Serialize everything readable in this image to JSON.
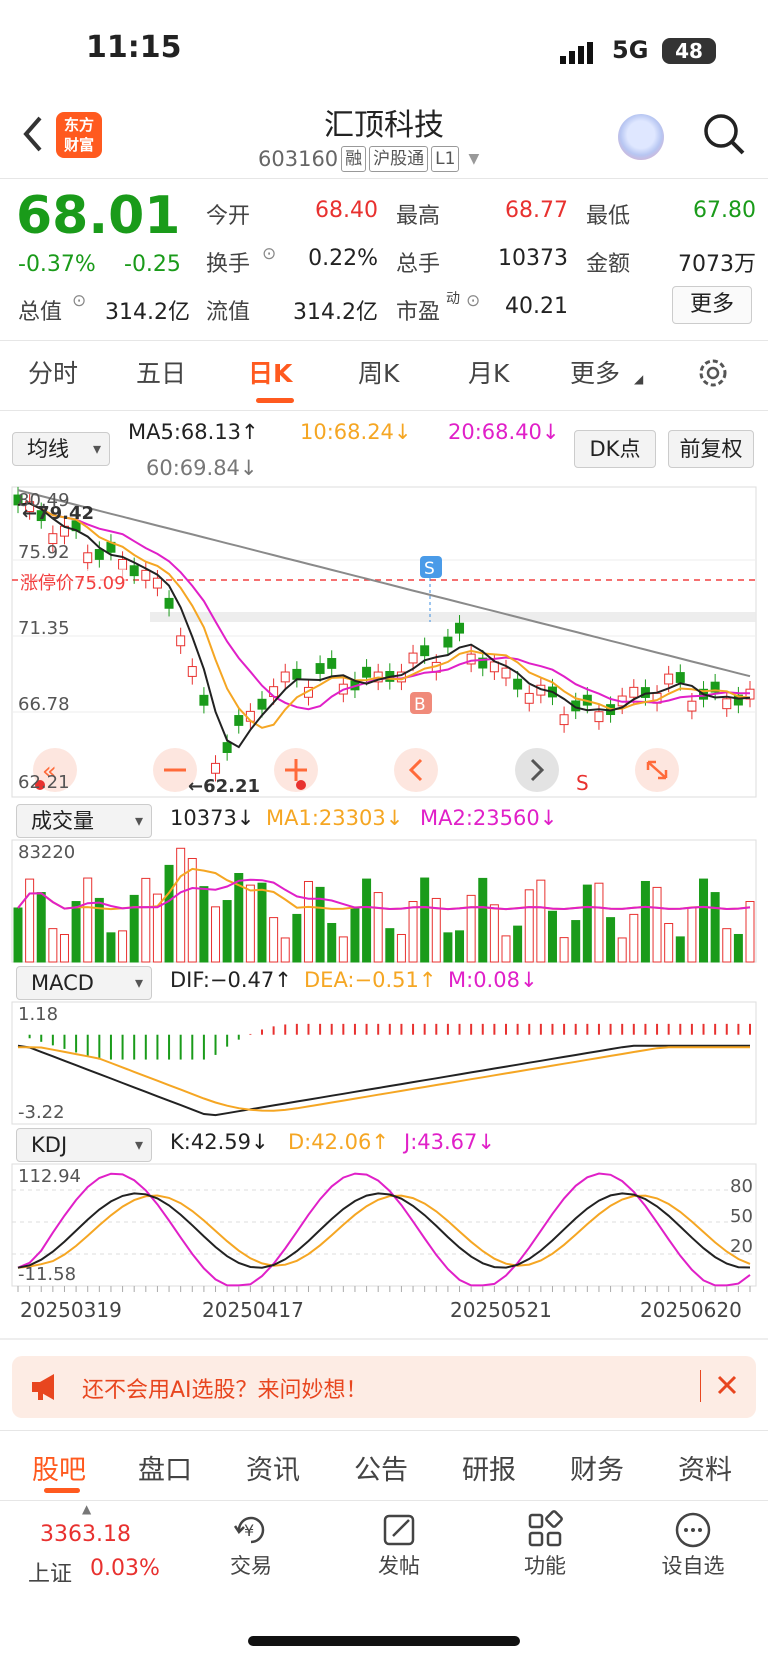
{
  "status_bar": {
    "time": "11:15",
    "network": "5G",
    "battery": "48"
  },
  "header": {
    "logo_text_1": "东方",
    "logo_text_2": "财富",
    "stock_name": "汇顶科技",
    "stock_code": "603160",
    "tags": [
      "融",
      "沪股通",
      "L1"
    ]
  },
  "quote": {
    "price": "68.01",
    "change_pct": "-0.37%",
    "change_amt": "-0.25",
    "open_label": "今开",
    "open": "68.40",
    "high_label": "最高",
    "high": "68.77",
    "low_label": "最低",
    "low": "67.80",
    "turnover_label": "换手",
    "turnover": "0.22%",
    "volume_label": "总手",
    "volume": "10373",
    "amount_label": "金额",
    "amount": "7073万",
    "mktcap_label": "总值",
    "mktcap": "314.2亿",
    "float_label": "流值",
    "float_cap": "314.2亿",
    "pe_label": "市盈",
    "pe_sup": "动",
    "pe": "40.21",
    "more_label": "更多"
  },
  "kline_tabs": [
    "分时",
    "五日",
    "日K",
    "周K",
    "月K",
    "更多"
  ],
  "active_tab": "日K",
  "ma_row": {
    "select": "均线",
    "ma5": "MA5:68.13↑",
    "ma10": "10:68.24↓",
    "ma20": "20:68.40↓",
    "ma60": "60:69.84↓",
    "dk_button": "DK点",
    "adjust_button": "前复权"
  },
  "main_chart": {
    "y_labels": [
      "80.49",
      "75.92",
      "71.35",
      "66.78",
      "62.21"
    ],
    "max_marker": "←79.42",
    "min_marker": "←62.21",
    "limit_label": "涨停价75.09",
    "buy_marker": "B",
    "sell_marker": "S",
    "s_marker": "S"
  },
  "volume_row": {
    "select": "成交量",
    "vol": "10373↓",
    "ma1": "MA1:23303↓",
    "ma2": "MA2:23560↓",
    "y_label": "83220"
  },
  "macd_row": {
    "select": "MACD",
    "dif": "DIF:−0.47↑",
    "dea": "DEA:−0.51↑",
    "m": "M:0.08↓",
    "y_top": "1.18",
    "y_bottom": "-3.22"
  },
  "kdj_row": {
    "select": "KDJ",
    "k": "K:42.59↓",
    "d": "D:42.06↑",
    "j": "J:43.67↓",
    "y_top": "112.94",
    "y_bottom": "-11.58",
    "levels": [
      "80",
      "50",
      "20"
    ]
  },
  "dates": [
    "20250319",
    "20250417",
    "20250521",
    "20250620"
  ],
  "ai_banner": {
    "text": "还不会用AI选股？来问妙想！"
  },
  "bottom_tabs": [
    "股吧",
    "盘口",
    "资讯",
    "公告",
    "研报",
    "财务",
    "资料"
  ],
  "index": {
    "value": "3363.18",
    "name": "上证",
    "pct": "0.03%"
  },
  "toolbar": [
    "交易",
    "发帖",
    "功能",
    "设自选"
  ],
  "colors": {
    "up": "#e8312f",
    "down": "#1a9b1a",
    "accent": "#ff5a1f",
    "ma10": "#f5a623",
    "ma20": "#e020c8"
  }
}
